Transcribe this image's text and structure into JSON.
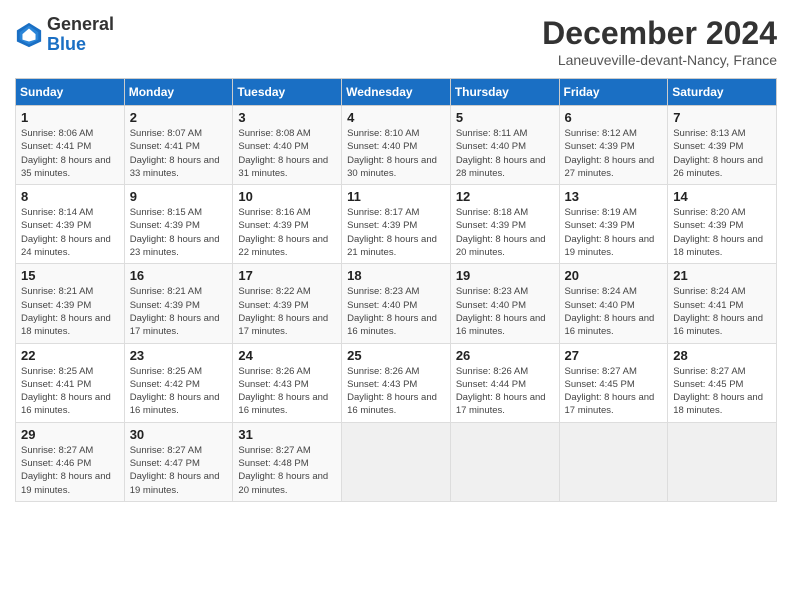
{
  "header": {
    "logo_general": "General",
    "logo_blue": "Blue",
    "month_title": "December 2024",
    "location": "Laneuveville-devant-Nancy, France"
  },
  "days_of_week": [
    "Sunday",
    "Monday",
    "Tuesday",
    "Wednesday",
    "Thursday",
    "Friday",
    "Saturday"
  ],
  "weeks": [
    [
      {
        "day": "1",
        "sunrise": "8:06 AM",
        "sunset": "4:41 PM",
        "daylight": "8 hours and 35 minutes."
      },
      {
        "day": "2",
        "sunrise": "8:07 AM",
        "sunset": "4:41 PM",
        "daylight": "8 hours and 33 minutes."
      },
      {
        "day": "3",
        "sunrise": "8:08 AM",
        "sunset": "4:40 PM",
        "daylight": "8 hours and 31 minutes."
      },
      {
        "day": "4",
        "sunrise": "8:10 AM",
        "sunset": "4:40 PM",
        "daylight": "8 hours and 30 minutes."
      },
      {
        "day": "5",
        "sunrise": "8:11 AM",
        "sunset": "4:40 PM",
        "daylight": "8 hours and 28 minutes."
      },
      {
        "day": "6",
        "sunrise": "8:12 AM",
        "sunset": "4:39 PM",
        "daylight": "8 hours and 27 minutes."
      },
      {
        "day": "7",
        "sunrise": "8:13 AM",
        "sunset": "4:39 PM",
        "daylight": "8 hours and 26 minutes."
      }
    ],
    [
      {
        "day": "8",
        "sunrise": "8:14 AM",
        "sunset": "4:39 PM",
        "daylight": "8 hours and 24 minutes."
      },
      {
        "day": "9",
        "sunrise": "8:15 AM",
        "sunset": "4:39 PM",
        "daylight": "8 hours and 23 minutes."
      },
      {
        "day": "10",
        "sunrise": "8:16 AM",
        "sunset": "4:39 PM",
        "daylight": "8 hours and 22 minutes."
      },
      {
        "day": "11",
        "sunrise": "8:17 AM",
        "sunset": "4:39 PM",
        "daylight": "8 hours and 21 minutes."
      },
      {
        "day": "12",
        "sunrise": "8:18 AM",
        "sunset": "4:39 PM",
        "daylight": "8 hours and 20 minutes."
      },
      {
        "day": "13",
        "sunrise": "8:19 AM",
        "sunset": "4:39 PM",
        "daylight": "8 hours and 19 minutes."
      },
      {
        "day": "14",
        "sunrise": "8:20 AM",
        "sunset": "4:39 PM",
        "daylight": "8 hours and 18 minutes."
      }
    ],
    [
      {
        "day": "15",
        "sunrise": "8:21 AM",
        "sunset": "4:39 PM",
        "daylight": "8 hours and 18 minutes."
      },
      {
        "day": "16",
        "sunrise": "8:21 AM",
        "sunset": "4:39 PM",
        "daylight": "8 hours and 17 minutes."
      },
      {
        "day": "17",
        "sunrise": "8:22 AM",
        "sunset": "4:39 PM",
        "daylight": "8 hours and 17 minutes."
      },
      {
        "day": "18",
        "sunrise": "8:23 AM",
        "sunset": "4:40 PM",
        "daylight": "8 hours and 16 minutes."
      },
      {
        "day": "19",
        "sunrise": "8:23 AM",
        "sunset": "4:40 PM",
        "daylight": "8 hours and 16 minutes."
      },
      {
        "day": "20",
        "sunrise": "8:24 AM",
        "sunset": "4:40 PM",
        "daylight": "8 hours and 16 minutes."
      },
      {
        "day": "21",
        "sunrise": "8:24 AM",
        "sunset": "4:41 PM",
        "daylight": "8 hours and 16 minutes."
      }
    ],
    [
      {
        "day": "22",
        "sunrise": "8:25 AM",
        "sunset": "4:41 PM",
        "daylight": "8 hours and 16 minutes."
      },
      {
        "day": "23",
        "sunrise": "8:25 AM",
        "sunset": "4:42 PM",
        "daylight": "8 hours and 16 minutes."
      },
      {
        "day": "24",
        "sunrise": "8:26 AM",
        "sunset": "4:43 PM",
        "daylight": "8 hours and 16 minutes."
      },
      {
        "day": "25",
        "sunrise": "8:26 AM",
        "sunset": "4:43 PM",
        "daylight": "8 hours and 16 minutes."
      },
      {
        "day": "26",
        "sunrise": "8:26 AM",
        "sunset": "4:44 PM",
        "daylight": "8 hours and 17 minutes."
      },
      {
        "day": "27",
        "sunrise": "8:27 AM",
        "sunset": "4:45 PM",
        "daylight": "8 hours and 17 minutes."
      },
      {
        "day": "28",
        "sunrise": "8:27 AM",
        "sunset": "4:45 PM",
        "daylight": "8 hours and 18 minutes."
      }
    ],
    [
      {
        "day": "29",
        "sunrise": "8:27 AM",
        "sunset": "4:46 PM",
        "daylight": "8 hours and 19 minutes."
      },
      {
        "day": "30",
        "sunrise": "8:27 AM",
        "sunset": "4:47 PM",
        "daylight": "8 hours and 19 minutes."
      },
      {
        "day": "31",
        "sunrise": "8:27 AM",
        "sunset": "4:48 PM",
        "daylight": "8 hours and 20 minutes."
      },
      null,
      null,
      null,
      null
    ]
  ]
}
